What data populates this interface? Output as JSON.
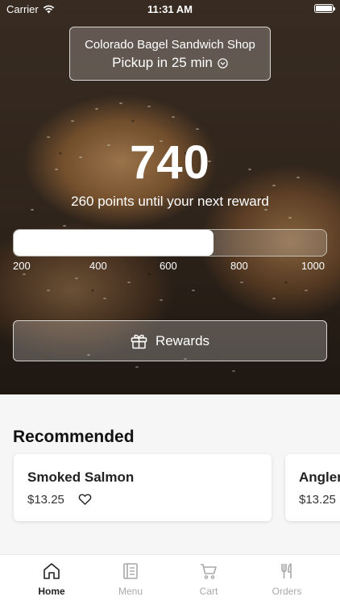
{
  "status_bar": {
    "carrier": "Carrier",
    "time": "11:31 AM"
  },
  "store": {
    "name": "Colorado Bagel Sandwich Shop",
    "pickup": "Pickup in 25 min"
  },
  "rewards": {
    "points": "740",
    "subtitle": "260 points until your next reward",
    "progress_fraction": 0.64,
    "ticks": [
      "200",
      "400",
      "600",
      "800",
      "1000"
    ],
    "button_label": "Rewards"
  },
  "recommended": {
    "title": "Recommended",
    "items": [
      {
        "name": "Smoked Salmon",
        "price": "$13.25"
      },
      {
        "name": "Angler",
        "price": "$13.25"
      }
    ]
  },
  "tabs": [
    {
      "label": "Home",
      "icon": "home-icon",
      "active": true
    },
    {
      "label": "Menu",
      "icon": "menu-book-icon",
      "active": false
    },
    {
      "label": "Cart",
      "icon": "cart-icon",
      "active": false
    },
    {
      "label": "Orders",
      "icon": "fork-knife-icon",
      "active": false
    }
  ],
  "colors": {
    "tab_active": "#222222",
    "tab_inactive": "#a8a8a8"
  }
}
